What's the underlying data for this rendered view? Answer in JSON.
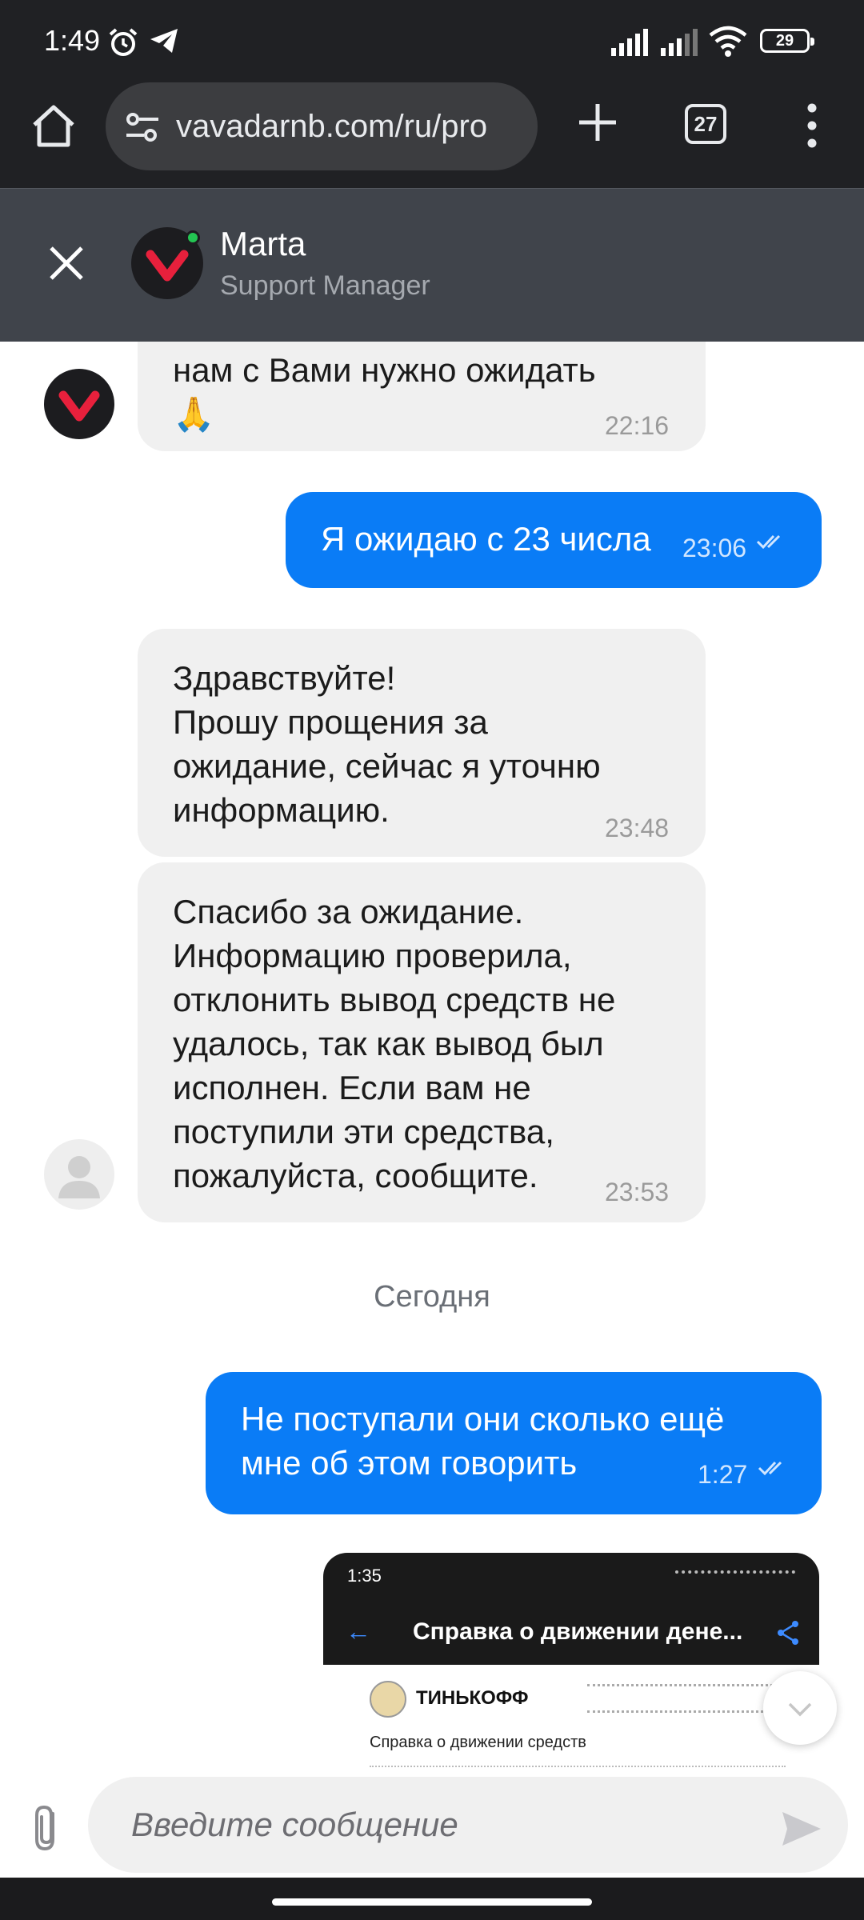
{
  "status_bar": {
    "time": "1:49",
    "battery": "29"
  },
  "browser": {
    "url": "vavadarnb.com/ru/pro",
    "tab_count": "27"
  },
  "chat_header": {
    "agent_name": "Marta",
    "agent_role": "Support Manager"
  },
  "messages": [
    {
      "direction": "in",
      "text": "нам с Вами нужно ожидать\n🙏",
      "time": "22:16"
    },
    {
      "direction": "out",
      "text": "Я ожидаю с 23 числа",
      "time": "23:06"
    },
    {
      "direction": "in",
      "text": "Здравствуйте!\nПрошу прощения за\nожидание, сейчас я уточню\nинформацию.",
      "time": "23:48"
    },
    {
      "direction": "in",
      "text": "Спасибо за ожидание.\nИнформацию проверила,\nотклонить вывод средств не\nудалось, так как вывод был\nисполнен. Если вам не\nпоступили эти средства,\nпожалуйста, сообщите.",
      "time": "23:53"
    },
    {
      "direction": "out",
      "text": "Не поступали они сколько ещё\nмне об этом говорить",
      "time": "1:27"
    }
  ],
  "date_separator": "Сегодня",
  "image_preview": {
    "time": "1:35",
    "title": "Справка о движении дене...",
    "bank_name": "ТИНЬКОФФ",
    "doc_heading": "Справка о движении средств"
  },
  "composer": {
    "placeholder": "Введите сообщение"
  },
  "colors": {
    "outgoing_bubble": "#0a7cf6",
    "incoming_bubble": "#f0f0f0",
    "header_bg": "#40444b",
    "online": "#23c552"
  }
}
